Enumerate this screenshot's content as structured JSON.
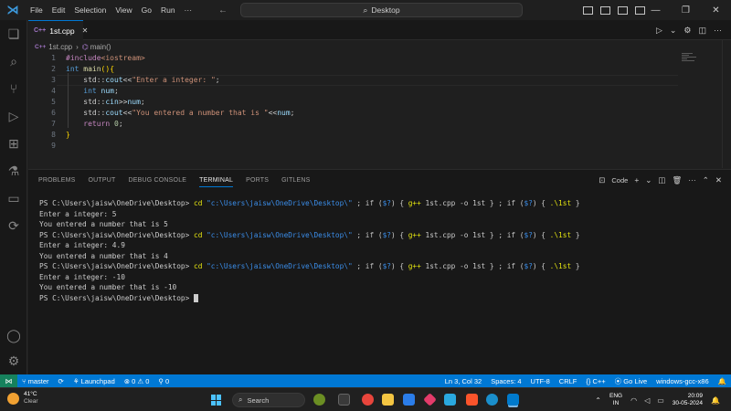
{
  "titlebar": {
    "menu": [
      "File",
      "Edit",
      "Selection",
      "View",
      "Go",
      "Run",
      "···"
    ],
    "search": "Desktop"
  },
  "tab": {
    "name": "1st.cpp",
    "icon": "C++"
  },
  "breadcrumb": {
    "file": "1st.cpp",
    "symbol": "main()"
  },
  "code": {
    "line_numbers": [
      "1",
      "2",
      "3",
      "4",
      "5",
      "6",
      "7",
      "8",
      "9"
    ]
  },
  "panel": {
    "tabs": [
      "PROBLEMS",
      "OUTPUT",
      "DEBUG CONSOLE",
      "TERMINAL",
      "PORTS",
      "GITLENS"
    ],
    "active_tab": "TERMINAL",
    "shell_label": "Code"
  },
  "terminal": {
    "prompt": "PS C:\\Users\\jaisw\\OneDrive\\Desktop> ",
    "cmd_cd": "cd",
    "cmd_path": "\"c:\\Users\\jaisw\\OneDrive\\Desktop\\\"",
    "cmd_sep1": " ; if (",
    "cmd_q": "$?",
    "cmd_sep2": ") { ",
    "cmd_gpp": "g++",
    "cmd_args": " 1st.cpp -o 1st } ; if (",
    "cmd_sep3": ") { ",
    "cmd_run": ".\\1st",
    "cmd_end": " }",
    "outputs": [
      [
        "Enter a integer: 5",
        "You entered a number that is 5"
      ],
      [
        "Enter a integer: 4.9",
        "You entered a number that is 4"
      ],
      [
        "Enter a integer: -10",
        "You entered a number that is -10"
      ]
    ],
    "final_prompt": "PS C:\\Users\\jaisw\\OneDrive\\Desktop> "
  },
  "statusbar": {
    "branch": "master",
    "launchpad": "Launchpad",
    "errors": "0",
    "warnings": "0",
    "ports": "0",
    "position": "Ln 3, Col 32",
    "spaces": "Spaces: 4",
    "encoding": "UTF-8",
    "eol": "CRLF",
    "language": "C++",
    "golive": "Go Live",
    "compiler": "windows-gcc-x86"
  },
  "taskbar": {
    "temp": "41°C",
    "weather": "Clear",
    "search": "Search",
    "lang": "ENG",
    "region": "IN",
    "time": "20:09",
    "date": "30-05-2024"
  },
  "colors": {
    "accent": "#0078d4",
    "statusbar": "#0078d4",
    "remote": "#16825d"
  }
}
